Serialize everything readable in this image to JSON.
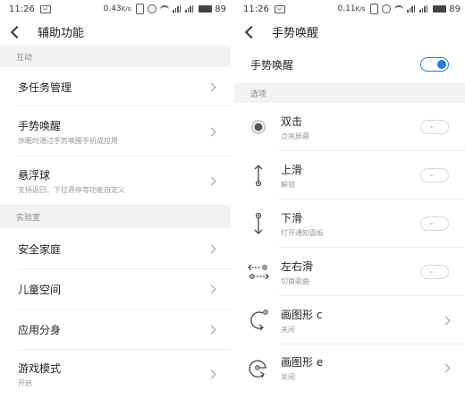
{
  "left": {
    "status": {
      "time": "11:26",
      "rate": "0.43",
      "rate_unit": "K/s",
      "battery": "89"
    },
    "header": {
      "title": "辅助功能"
    },
    "sections": [
      {
        "label": "互动"
      },
      {
        "label": "实验室"
      }
    ],
    "items": [
      {
        "label": "多任务管理",
        "sub": ""
      },
      {
        "label": "手势唤醒",
        "sub": "休眠时通过手势唤醒手机或应用"
      },
      {
        "label": "悬浮球",
        "sub": "支持返回、下拉悬停等功能自定义"
      },
      {
        "label": "安全家庭",
        "sub": ""
      },
      {
        "label": "儿童空间",
        "sub": ""
      },
      {
        "label": "应用分身",
        "sub": ""
      },
      {
        "label": "游戏模式",
        "sub": "开启"
      }
    ]
  },
  "right": {
    "status": {
      "time": "11:26",
      "rate": "0.11",
      "rate_unit": "K/s",
      "battery": "89"
    },
    "header": {
      "title": "手势唤醒"
    },
    "master": {
      "label": "手势唤醒",
      "enabled": true
    },
    "section": {
      "label": "选项"
    },
    "items": [
      {
        "label": "双击",
        "sub": "点亮屏幕",
        "icon": "double-tap-icon",
        "control": "switch-off"
      },
      {
        "label": "上滑",
        "sub": "解锁",
        "icon": "swipe-up-icon",
        "control": "switch-off"
      },
      {
        "label": "下滑",
        "sub": "打开通知面板",
        "icon": "swipe-down-icon",
        "control": "switch-off"
      },
      {
        "label": "左右滑",
        "sub": "切换歌曲",
        "icon": "swipe-left-right-icon",
        "control": "switch-off"
      },
      {
        "label": "画图形 c",
        "sub": "关闭",
        "icon": "draw-c-icon",
        "control": "chevron"
      },
      {
        "label": "画图形 e",
        "sub": "关闭",
        "icon": "draw-e-icon",
        "control": "chevron"
      }
    ]
  },
  "colors": {
    "accent": "#1f7bdc",
    "section_bg": "#f2f2f2",
    "divider": "#ececec"
  }
}
